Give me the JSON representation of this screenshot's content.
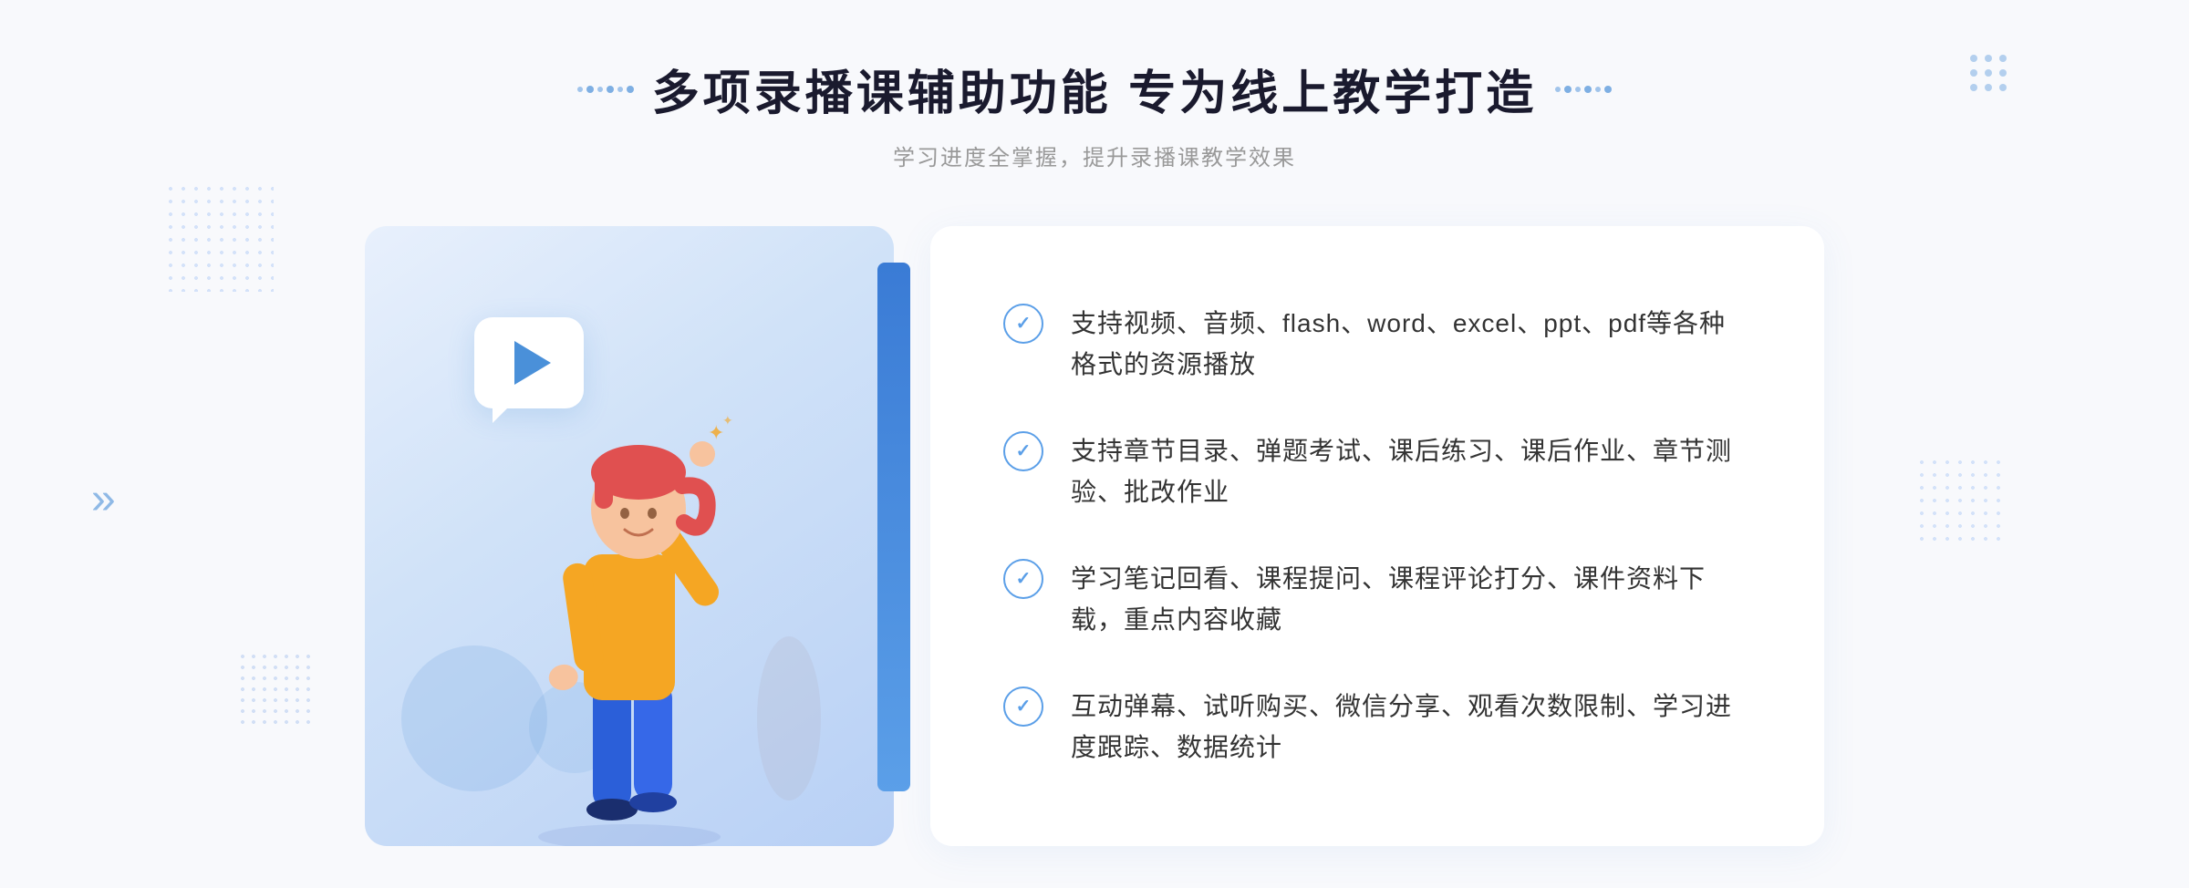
{
  "header": {
    "main_title": "多项录播课辅助功能 专为线上教学打造",
    "sub_title": "学习进度全掌握，提升录播课教学效果"
  },
  "features": [
    {
      "id": "feature-1",
      "text": "支持视频、音频、flash、word、excel、ppt、pdf等各种格式的资源播放"
    },
    {
      "id": "feature-2",
      "text": "支持章节目录、弹题考试、课后练习、课后作业、章节测验、批改作业"
    },
    {
      "id": "feature-3",
      "text": "学习笔记回看、课程提问、课程评论打分、课件资料下载，重点内容收藏"
    },
    {
      "id": "feature-4",
      "text": "互动弹幕、试听购买、微信分享、观看次数限制、学习进度跟踪、数据统计"
    }
  ],
  "icons": {
    "play": "▶",
    "check": "✓",
    "chevron": "»"
  },
  "colors": {
    "primary": "#4a90d9",
    "primary_light": "#5b9fe8",
    "title": "#1a1a2e",
    "text": "#333333",
    "subtitle": "#999999",
    "bg": "#f8f9fc",
    "card_bg": "#ffffff",
    "illustration_bg": "#d4e6f7"
  }
}
